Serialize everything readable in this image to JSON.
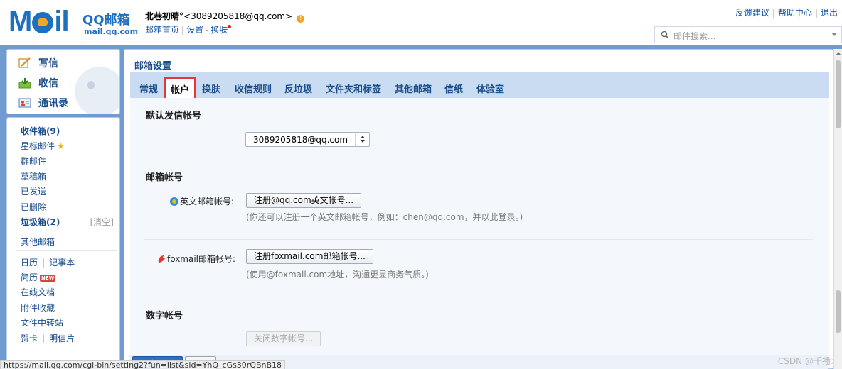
{
  "header": {
    "logo_word": "M",
    "logo_word_tail": "il",
    "logo_cn": "QQ邮箱",
    "logo_url": "mail.qq.com",
    "user_name": "北巷初晴°",
    "user_email": "<3089205818@qq.com>",
    "links": [
      "邮箱首页",
      "设置",
      "换肤"
    ],
    "top_right": [
      "反馈建议",
      "帮助中心",
      "退出"
    ],
    "search_placeholder": "邮件搜索..."
  },
  "nav": {
    "compose": "写信",
    "inbox": "收信",
    "contacts": "通讯录",
    "items": {
      "inbox_count": "收件箱(9)",
      "starred": "星标邮件",
      "group": "群邮件",
      "drafts": "草稿箱",
      "sent": "已发送",
      "deleted": "已删除",
      "junk": "垃圾箱(2)",
      "clear": "[清空]",
      "other_mailboxes": "其他邮箱",
      "calendar": "日历",
      "notes": "记事本",
      "resume": "简历",
      "new_badge": "NEW",
      "online_docs": "在线文档",
      "attachments": "附件收藏",
      "file_transfer": "文件中转站",
      "cards": "贺卡",
      "postcards": "明信片"
    }
  },
  "main": {
    "title": "邮箱设置",
    "tabs": [
      "常规",
      "帐户",
      "换肤",
      "收信规则",
      "反垃圾",
      "文件夹和标签",
      "其他邮箱",
      "信纸",
      "体验室"
    ],
    "active_tab": "帐户",
    "sections": {
      "default_sender": "默认发信帐号",
      "default_sender_value": "3089205818@qq.com",
      "mailbox_accounts": "邮箱帐号",
      "english_label": "英文邮箱帐号:",
      "english_button": "注册@qq.com英文帐号...",
      "english_hint": "(你还可以注册一个英文邮箱帐号，例如：chen@qq.com，并以此登录。)",
      "foxmail_label": "foxmail邮箱帐号:",
      "foxmail_button": "注册foxmail.com邮箱帐号...",
      "foxmail_hint": "(使用@foxmail.com地址，沟通更显商务气质。)",
      "digital_accounts": "数字帐号",
      "digital_button": "关闭数字帐号..."
    },
    "save_button": "保存更改",
    "cancel_button": "取消"
  },
  "status_url": "https://mail.qq.com/cgi-bin/setting2?fun=list&sid=YhQ_cGs30rQBnB18",
  "watermark": "CSDN @千播:"
}
